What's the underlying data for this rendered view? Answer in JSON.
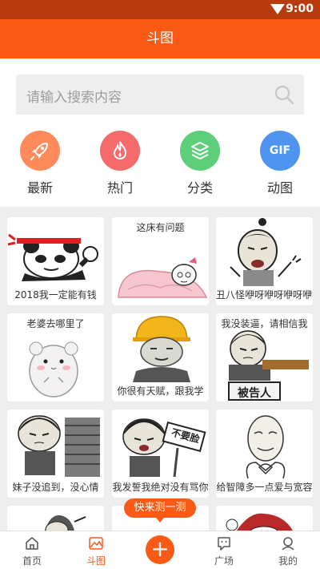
{
  "status_bar": {
    "time": "9:00"
  },
  "app_bar": {
    "title": "斗图"
  },
  "search": {
    "placeholder": "请输入搜索内容"
  },
  "categories": [
    {
      "label": "最新",
      "color": "#ff8a5b",
      "icon": "rocket-icon"
    },
    {
      "label": "热门",
      "color": "#f56b6b",
      "icon": "flame-icon"
    },
    {
      "label": "分类",
      "color": "#5dcf7a",
      "icon": "layers-icon"
    },
    {
      "label": "动图",
      "color": "#4f95f0",
      "icon_text": "GIF"
    }
  ],
  "memes": [
    {
      "caption": "2018我一定能有钱"
    },
    {
      "caption": "这床有问题"
    },
    {
      "caption": "丑八怪咿呀咿呀咿呀咿呀"
    },
    {
      "caption": "老婆去哪里了"
    },
    {
      "caption": "你很有天赋，跟我学"
    },
    {
      "caption": "我没装逼，请相信我",
      "sign": "被告人"
    },
    {
      "caption": "妹子没追到，没心情"
    },
    {
      "caption": "我发誓我绝对没有骂你",
      "sign": "不要脸"
    },
    {
      "caption": "给智障多一点爱与宽容"
    }
  ],
  "floating_action": {
    "label": "快来测一测"
  },
  "tab_bar": {
    "items": [
      {
        "label": "首页",
        "icon": "home-icon"
      },
      {
        "label": "斗图",
        "icon": "image-icon",
        "active": true
      },
      {
        "label": "",
        "icon": "plus-icon"
      },
      {
        "label": "广场",
        "icon": "chat-icon"
      },
      {
        "label": "我的",
        "icon": "profile-icon"
      }
    ],
    "accent": "#fa5a15"
  }
}
